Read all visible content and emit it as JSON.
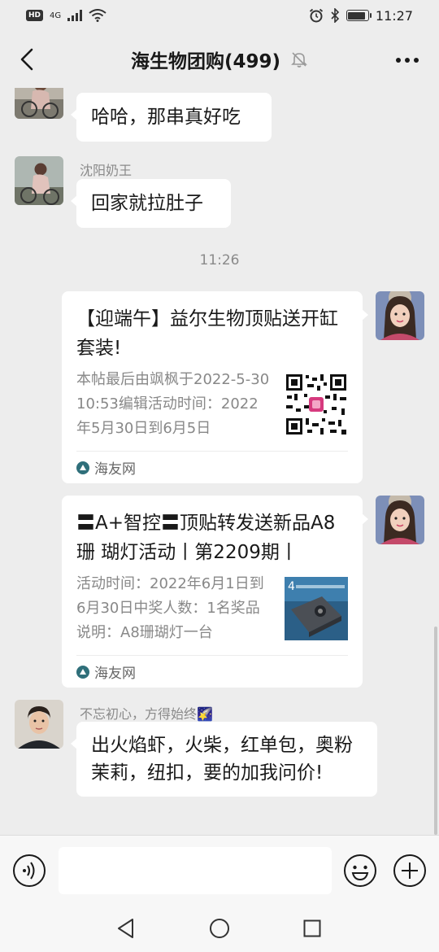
{
  "status_bar": {
    "hd_label": "HD",
    "network_label": "4G",
    "time": "11:27"
  },
  "header": {
    "title": "海生物团购(499)",
    "back_icon": "chevron-left-icon",
    "mute_icon": "bell-muted-icon",
    "more_icon": "ellipsis-icon"
  },
  "messages": [
    {
      "type": "text",
      "sender": "",
      "text": "哈哈，那串真好吃"
    },
    {
      "type": "text",
      "sender": "沈阳奶王",
      "text": "回家就拉肚子"
    },
    {
      "type": "time",
      "text": "11:26"
    },
    {
      "type": "card",
      "title": "【迎端午】益尔生物顶贴送开缸套装!",
      "desc": "本帖最后由飒枫于2022-5-3010:53编辑活动时间：2022年5月30日到6月5日",
      "source": "海友网"
    },
    {
      "type": "card",
      "title": "〓A+智控〓顶贴转发送新品A8珊 瑚灯活动丨第2209期丨",
      "desc": "活动时间：2022年6月1日到6月30日中奖人数：1名奖品说明：A8珊瑚灯一台",
      "source": "海友网"
    },
    {
      "type": "text",
      "sender": "不忘初心，方得始终🌠",
      "text": "出火焰虾，火柴，红单包，奥粉茉莉，纽扣，要的加我问价!"
    }
  ],
  "input_bar": {
    "voice_icon": "voice-icon",
    "emoji_icon": "emoji-icon",
    "plus_icon": "plus-icon",
    "input_value": ""
  },
  "colors": {
    "background": "#ededed",
    "bubble": "#ffffff",
    "meta_text": "#8a8a8a"
  }
}
